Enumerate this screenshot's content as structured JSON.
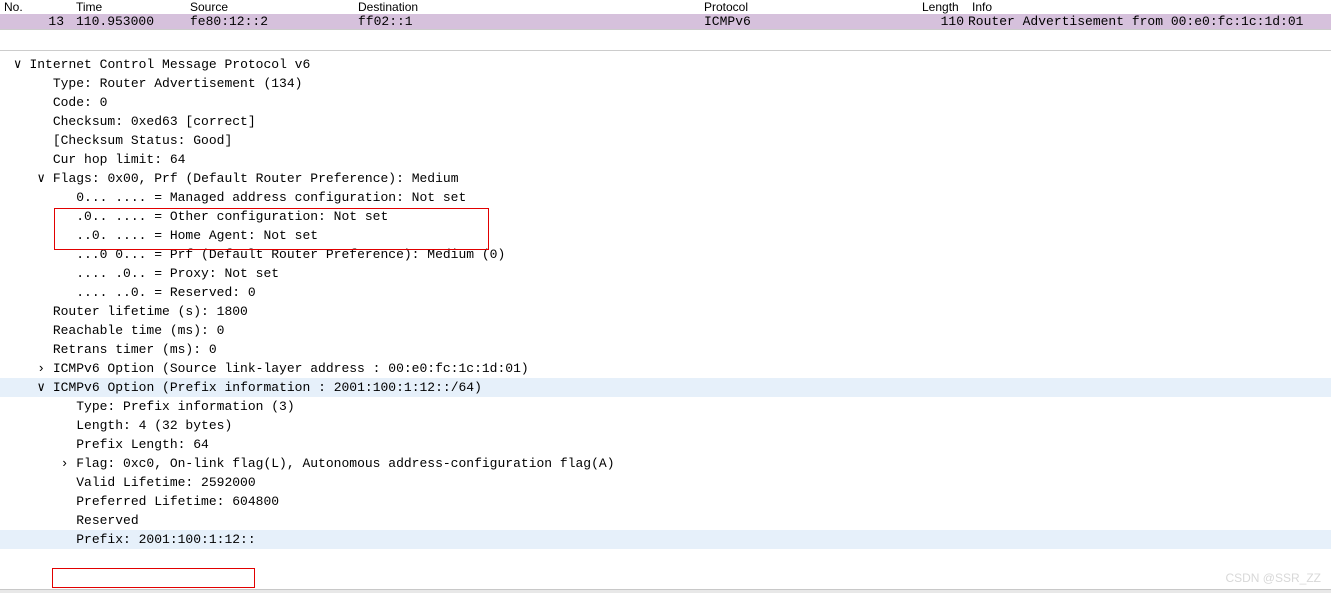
{
  "columns": {
    "no": "No.",
    "time": "Time",
    "source": "Source",
    "destination": "Destination",
    "protocol": "Protocol",
    "length": "Length",
    "info": "Info"
  },
  "row": {
    "no": "13",
    "time": "110.953000",
    "source": "fe80:12::2",
    "destination": "ff02::1",
    "protocol": "ICMPv6",
    "length": "110",
    "info": "Router Advertisement from 00:e0:fc:1c:1d:01"
  },
  "tree": {
    "icmp_header": "Internet Control Message Protocol v6",
    "type": "Type: Router Advertisement (134)",
    "code": "Code: 0",
    "checksum": "Checksum: 0xed63 [correct]",
    "checksum_status": "[Checksum Status: Good]",
    "cur_hop": "Cur hop limit: 64",
    "flags": "Flags: 0x00, Prf (Default Router Preference): Medium",
    "flag_m": "0... .... = Managed address configuration: Not set",
    "flag_o": ".0.. .... = Other configuration: Not set",
    "flag_h": "..0. .... = Home Agent: Not set",
    "flag_prf": "...0 0... = Prf (Default Router Preference): Medium (0)",
    "flag_p": ".... .0.. = Proxy: Not set",
    "flag_r": ".... ..0. = Reserved: 0",
    "router_life": "Router lifetime (s): 1800",
    "reachable": "Reachable time (ms): 0",
    "retrans": "Retrans timer (ms): 0",
    "opt_slla": "ICMPv6 Option (Source link-layer address : 00:e0:fc:1c:1d:01)",
    "opt_prefix": "ICMPv6 Option (Prefix information : 2001:100:1:12::/64)",
    "pi_type": "Type: Prefix information (3)",
    "pi_len": "Length: 4 (32 bytes)",
    "pi_plen": "Prefix Length: 64",
    "pi_flag": "Flag: 0xc0, On-link flag(L), Autonomous address-configuration flag(A)",
    "pi_valid": "Valid Lifetime: 2592000",
    "pi_pref": "Preferred Lifetime: 604800",
    "pi_res": "Reserved",
    "pi_prefix": "Prefix: 2001:100:1:12::"
  },
  "watermark": "CSDN @SSR_ZZ"
}
